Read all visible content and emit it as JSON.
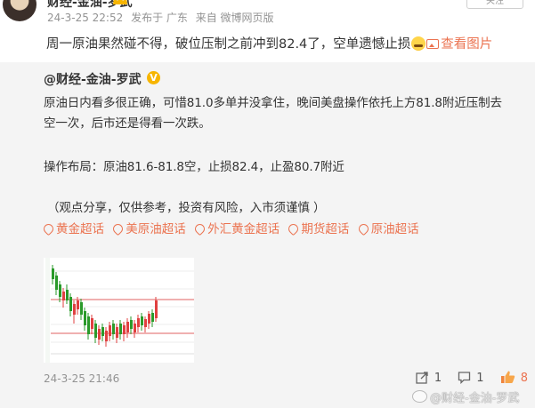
{
  "post": {
    "username": "财经-金油-罗武",
    "follow_label": "关注",
    "timestamp": "24-3-25 22:52",
    "source": "发布于 广东",
    "via": "来自 微博网页版",
    "text": "周一原油果然碰不得，破位压制之前冲到82.4了，空单遗憾止损",
    "view_pic_label": "查看图片"
  },
  "repost": {
    "author": "@财经-金油-罗武",
    "verify_badge": "V",
    "lines": [
      "原油日内看多很正确，可惜81.0多单并没拿住，晚间美盘操作依托上方81.8附近压制去",
      "空一次，后市还是得看一次跌。",
      "操作布局：原油81.6-81.8空，止损82.4，止盈80.7附近",
      "（观点分享，仅供参考，投资有风险，入市须谨慎 ）"
    ],
    "topics": [
      "黄金超话",
      "美原油超话",
      "外汇黄金超话",
      "期货超话",
      "原油超话"
    ],
    "timestamp": "24-3-25 21:46",
    "share_count": "1",
    "comment_count": "1",
    "like_count": "8",
    "watermark": "@财经-金油-罗武"
  },
  "icons": {
    "share": "share-icon",
    "comment": "comment-icon",
    "like": "thumbs-up-icon",
    "picture": "picture-icon",
    "topic": "topic-diamond-icon"
  },
  "colors": {
    "accent": "#eb7350",
    "candle_up": "#e04040",
    "candle_down": "#2a9a2a",
    "verify": "#f7b500"
  }
}
